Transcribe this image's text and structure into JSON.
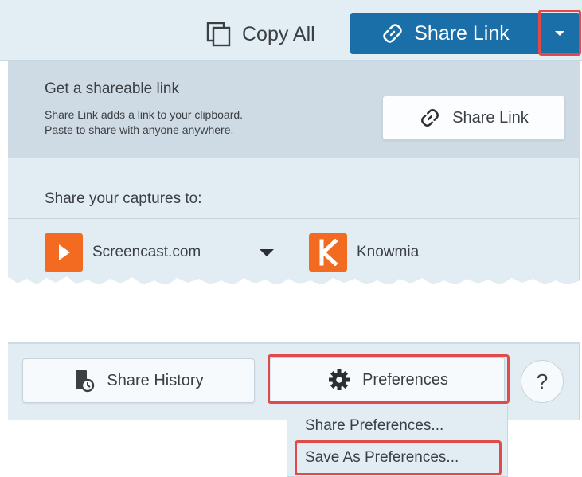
{
  "toolbar": {
    "copy_all_label": "Copy All",
    "share_link_label": "Share Link",
    "accent_color": "#1a6fa9"
  },
  "panel": {
    "shareable": {
      "title": "Get a shareable link",
      "description_line1": "Share Link adds a link to your clipboard.",
      "description_line2": "Paste to share with anyone anywhere.",
      "button_label": "Share Link"
    },
    "captures_title": "Share your captures to:",
    "destinations": [
      {
        "label": "Screencast.com",
        "icon": "screencast-icon",
        "color": "#f26b21"
      },
      {
        "label": "Knowmia",
        "icon": "knowmia-icon",
        "color": "#f26b21"
      }
    ]
  },
  "bottom": {
    "share_history_label": "Share History",
    "preferences_label": "Preferences",
    "help_label": "?"
  },
  "menu": {
    "items": [
      "Share Preferences...",
      "Save As Preferences..."
    ]
  },
  "icons": {
    "copy": "copy-icon",
    "link": "link-icon",
    "history": "history-icon",
    "gear": "gear-icon",
    "dropdown": "chevron-down-icon"
  },
  "highlight_color": "#e04a4a"
}
